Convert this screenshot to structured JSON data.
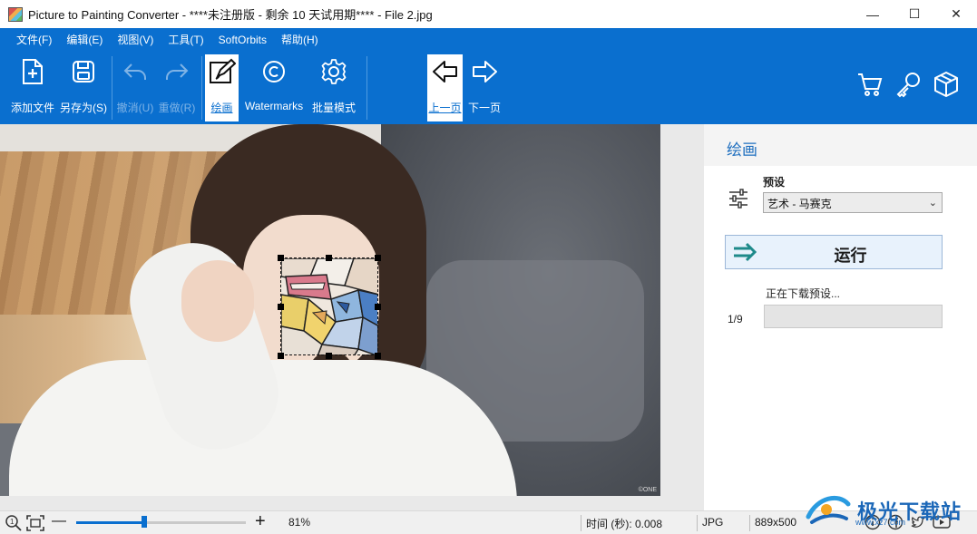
{
  "window": {
    "title": "Picture to Painting Converter - ****未注册版 - 剩余 10 天试用期**** - File 2.jpg",
    "minimize": "—",
    "maximize": "☐",
    "close": "✕"
  },
  "menu": [
    "文件(F)",
    "编辑(E)",
    "视图(V)",
    "工具(T)",
    "SoftOrbits",
    "帮助(H)"
  ],
  "toolbar": {
    "add_file": "添加文件",
    "save_as": "另存为(S)",
    "undo": "撤消(U)",
    "redo": "重做(R)",
    "paint": "绘画",
    "watermarks": "Watermarks",
    "batch": "批量模式",
    "prev_page": "上一页",
    "next_page": "下一页"
  },
  "icons": {
    "add_file": "add-file-icon",
    "save": "save-icon",
    "undo": "undo-icon",
    "redo": "redo-icon",
    "paint": "paint-icon",
    "watermark": "copyright-icon",
    "batch": "gear-icon",
    "prev": "arrow-left-icon",
    "next": "arrow-right-icon",
    "cart": "cart-icon",
    "key": "key-icon",
    "box": "box-icon"
  },
  "image": {
    "watermark": "©ONE"
  },
  "panel": {
    "title": "绘画",
    "preset_label": "预设",
    "preset_value": "艺术 - 马赛克",
    "run_label": "运行",
    "download_text": "正在下载预设...",
    "progress_count": "1/9",
    "progress_fraction": 0.0
  },
  "status": {
    "zoom": "81%",
    "zoom_level": 0.4,
    "time": "时间 (秒): 0.008",
    "format": "JPG",
    "dimensions": "889x500"
  },
  "brand": {
    "name": "极光下载站",
    "url": "www.xz7.com"
  },
  "colors": {
    "accent": "#0a6fcf",
    "panel_title": "#1f6fbf"
  }
}
